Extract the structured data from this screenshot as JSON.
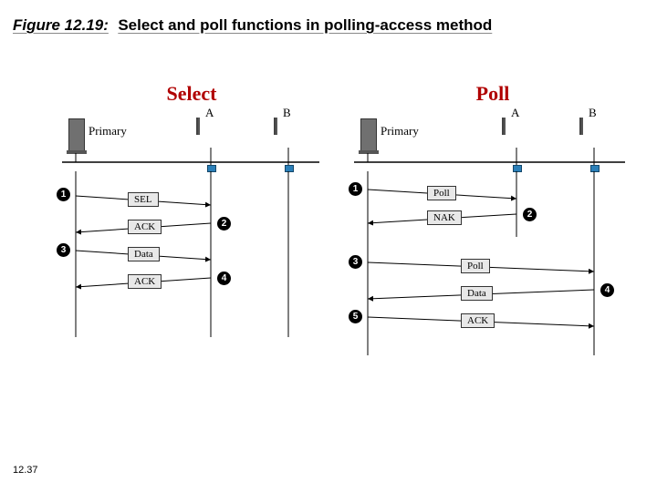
{
  "figure_number": "Figure 12.19:",
  "figure_caption": "Select and poll functions in polling-access method",
  "page_number": "12.37",
  "panels": {
    "select": {
      "title": "Select",
      "nodes": {
        "primary": "Primary",
        "a": "A",
        "b": "B"
      },
      "steps": [
        "1",
        "2",
        "3",
        "4"
      ],
      "messages": [
        "SEL",
        "ACK",
        "Data",
        "ACK"
      ]
    },
    "poll": {
      "title": "Poll",
      "nodes": {
        "primary": "Primary",
        "a": "A",
        "b": "B"
      },
      "steps": [
        "1",
        "2",
        "3",
        "4",
        "5"
      ],
      "messages": [
        "Poll",
        "NAK",
        "Poll",
        "Data",
        "ACK"
      ]
    }
  }
}
